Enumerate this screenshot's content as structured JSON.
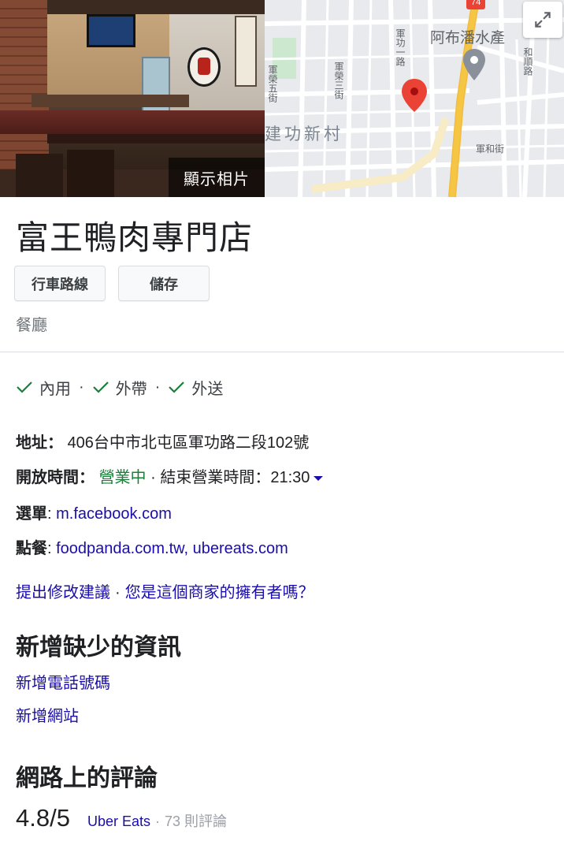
{
  "media": {
    "show_photos_label": "顯示相片"
  },
  "map": {
    "poi_label": "阿布潘水產",
    "road_number": "74",
    "district_label": "建功新村",
    "streets": {
      "a": "軍榮五街",
      "b": "軍榮三街",
      "c": "軍功一路",
      "d": "和順路",
      "e": "軍和街"
    }
  },
  "business": {
    "name": "富王鴨肉專門店",
    "category": "餐廳"
  },
  "actions": {
    "directions_label": "行車路線",
    "save_label": "儲存"
  },
  "services": [
    "內用",
    "外帶",
    "外送"
  ],
  "info": {
    "address_key": "地址",
    "address_value": "406台中市北屯區軍功路二段102號",
    "hours_key": "開放時間",
    "hours_status": "營業中",
    "hours_detail": "結束營業時間：21:30",
    "menu_key": "選單",
    "menu_value": "m.facebook.com",
    "order_key": "點餐",
    "order_value": "foodpanda.com.tw, ubereats.com"
  },
  "edit": {
    "suggest_label": "提出修改建議",
    "owner_label": "您是這個商家的擁有者嗎？"
  },
  "missing": {
    "heading": "新增缺少的資訊",
    "add_phone": "新增電話號碼",
    "add_website": "新增網站"
  },
  "reviews": {
    "heading": "網路上的評論",
    "rating": "4.8/5",
    "source": "Uber Eats",
    "count": "73 則評論"
  },
  "colors": {
    "link": "#1a0dab",
    "open_green": "#188038",
    "pin_red": "#ea4335",
    "road_yellow": "#f6c544"
  }
}
